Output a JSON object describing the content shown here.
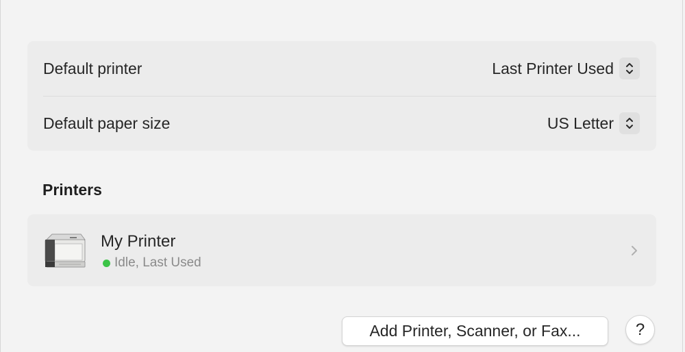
{
  "defaults": {
    "rows": [
      {
        "label": "Default printer",
        "value": "Last Printer Used"
      },
      {
        "label": "Default paper size",
        "value": "US Letter"
      }
    ]
  },
  "printers": {
    "section_title": "Printers",
    "items": [
      {
        "name": "My Printer",
        "status": "Idle, Last Used",
        "status_color": "#3cc447"
      }
    ]
  },
  "footer": {
    "add_button_label": "Add Printer, Scanner, or Fax...",
    "help_button_label": "?"
  },
  "icons": {
    "popup_stepper": "up-down-chevron-icon",
    "printer": "laser-printer-icon",
    "disclosure": "chevron-right-icon"
  }
}
